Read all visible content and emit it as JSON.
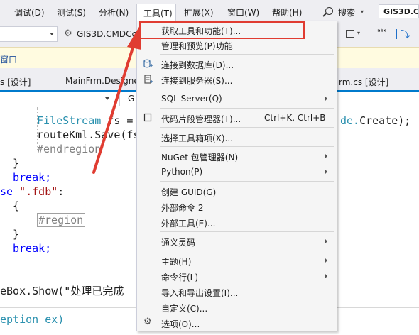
{
  "menubar": {
    "items": [
      {
        "label": "调试(D)"
      },
      {
        "label": "测试(S)"
      },
      {
        "label": "分析(N)"
      },
      {
        "label": "工具(T)"
      },
      {
        "label": "扩展(X)"
      },
      {
        "label": "窗口(W)"
      },
      {
        "label": "帮助(H)"
      }
    ],
    "search_label": "搜索",
    "solution_name": "GIS3D.CMDC"
  },
  "toolbar": {
    "project_label": "GIS3D.CMDCc"
  },
  "infobar": {
    "text": "窗口"
  },
  "tabs": [
    {
      "label": "s [设计]"
    },
    {
      "label": "MainFrm.Designe"
    },
    {
      "label": "rm.cs [设计]"
    }
  ],
  "navbar": {
    "right_text": "G"
  },
  "code": {
    "line1": {
      "type": "FileStream",
      "rest": " fs = "
    },
    "line1_tail": {
      "plain": "de.",
      "method": "Create",
      "end": ");"
    },
    "line2": "routeKml.Save(fs",
    "line3": "#endregion",
    "line4": "}",
    "line5": "break;",
    "line6": {
      "kw": "se",
      "str": " \".fdb\"",
      "end": ":"
    },
    "line7": "{",
    "line8": "#region",
    "line9": "}",
    "line10": "break;",
    "line11": "eBox.Show(\"处理已完成",
    "line12": "eption ex)"
  },
  "menu": {
    "items": [
      {
        "label": "获取工具和功能(T)...",
        "shortcut": "",
        "submenu": false,
        "icon": ""
      },
      {
        "label": "管理和预览(P)功能",
        "shortcut": "",
        "submenu": false,
        "icon": ""
      },
      {
        "label": "连接到数据库(D)...",
        "shortcut": "",
        "submenu": false,
        "icon": "database-connect-icon"
      },
      {
        "label": "连接到服务器(S)...",
        "shortcut": "",
        "submenu": false,
        "icon": "server-connect-icon"
      },
      {
        "label": "SQL Server(Q)",
        "shortcut": "",
        "submenu": true,
        "icon": ""
      },
      {
        "label": "代码片段管理器(T)...",
        "shortcut": "Ctrl+K, Ctrl+B",
        "submenu": false,
        "icon": "snippet-icon"
      },
      {
        "label": "选择工具箱项(X)...",
        "shortcut": "",
        "submenu": false,
        "icon": ""
      },
      {
        "label": "NuGet 包管理器(N)",
        "shortcut": "",
        "submenu": true,
        "icon": ""
      },
      {
        "label": "Python(P)",
        "shortcut": "",
        "submenu": true,
        "icon": ""
      },
      {
        "label": "创建 GUID(G)",
        "shortcut": "",
        "submenu": false,
        "icon": ""
      },
      {
        "label": "外部命令 2",
        "shortcut": "",
        "submenu": false,
        "icon": ""
      },
      {
        "label": "外部工具(E)...",
        "shortcut": "",
        "submenu": false,
        "icon": ""
      },
      {
        "label": "通义灵码",
        "shortcut": "",
        "submenu": true,
        "icon": ""
      },
      {
        "label": "主题(H)",
        "shortcut": "",
        "submenu": true,
        "icon": ""
      },
      {
        "label": "命令行(L)",
        "shortcut": "",
        "submenu": true,
        "icon": ""
      },
      {
        "label": "导入和导出设置(I)...",
        "shortcut": "",
        "submenu": false,
        "icon": ""
      },
      {
        "label": "自定义(C)...",
        "shortcut": "",
        "submenu": false,
        "icon": ""
      },
      {
        "label": "选项(O)...",
        "shortcut": "",
        "submenu": false,
        "icon": "gear-icon"
      }
    ]
  },
  "colors": {
    "highlight_box": "#e03c31",
    "arrow": "#e03c31",
    "type": "#2b91af",
    "keyword": "#0000ff",
    "string": "#a31515",
    "comment": "#808080"
  }
}
